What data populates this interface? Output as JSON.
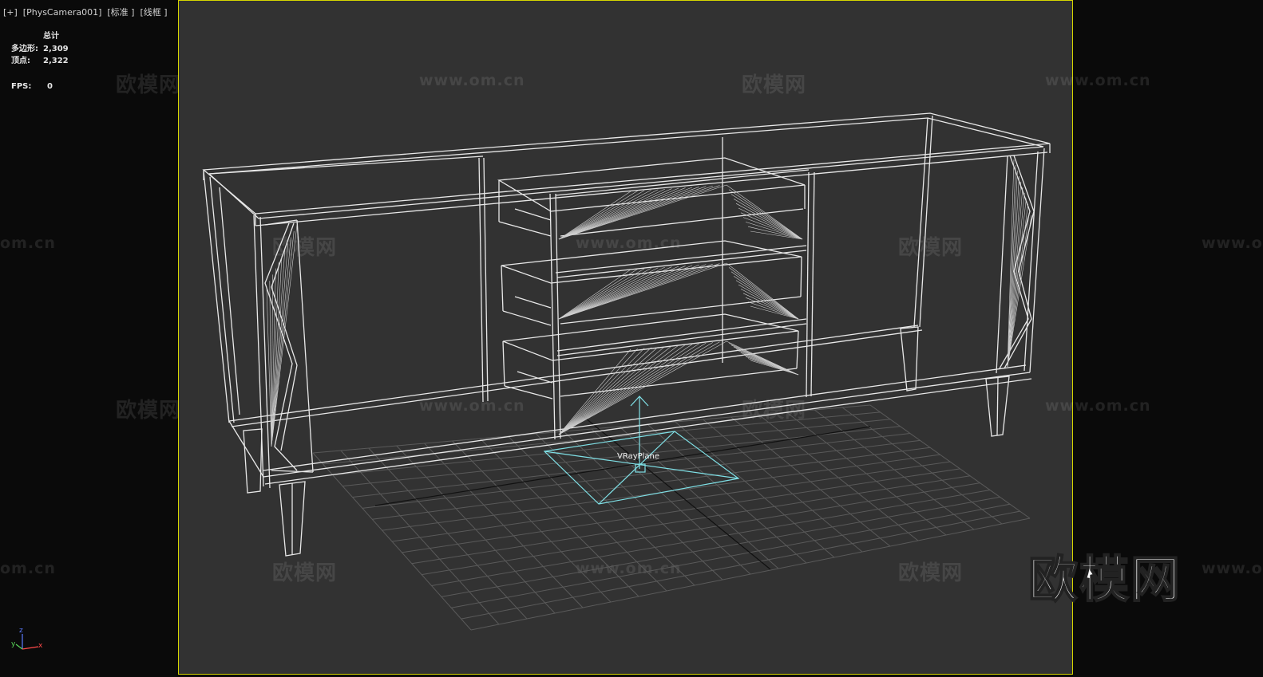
{
  "viewport": {
    "label": "[+]  [PhysCamera001]  [标准 ]  [线框 ]"
  },
  "stats": {
    "header": "总计",
    "polygons_label": "多边形:",
    "polygons_value": "2,309",
    "vertices_label": "顶点:",
    "vertices_value": "2,322",
    "fps_label": "FPS:",
    "fps_value": "0"
  },
  "scene": {
    "object_label": "VRayPlane"
  },
  "watermarks": {
    "brand_text": "欧模网",
    "url_text": "www.om.cn",
    "url_partial_left": "om.cn",
    "url_partial_right": "www.o"
  },
  "logo": {
    "text": "欧模网"
  },
  "axis_gizmo": {
    "x": "x",
    "y": "y",
    "z": "z"
  },
  "colors": {
    "background": "#0a0a0a",
    "viewport_bg": "#323232",
    "frame_border": "#d6d600",
    "wire": "#e8e8e8",
    "vray_plane": "#7fe0e6",
    "grid": "#5a5a5a"
  }
}
